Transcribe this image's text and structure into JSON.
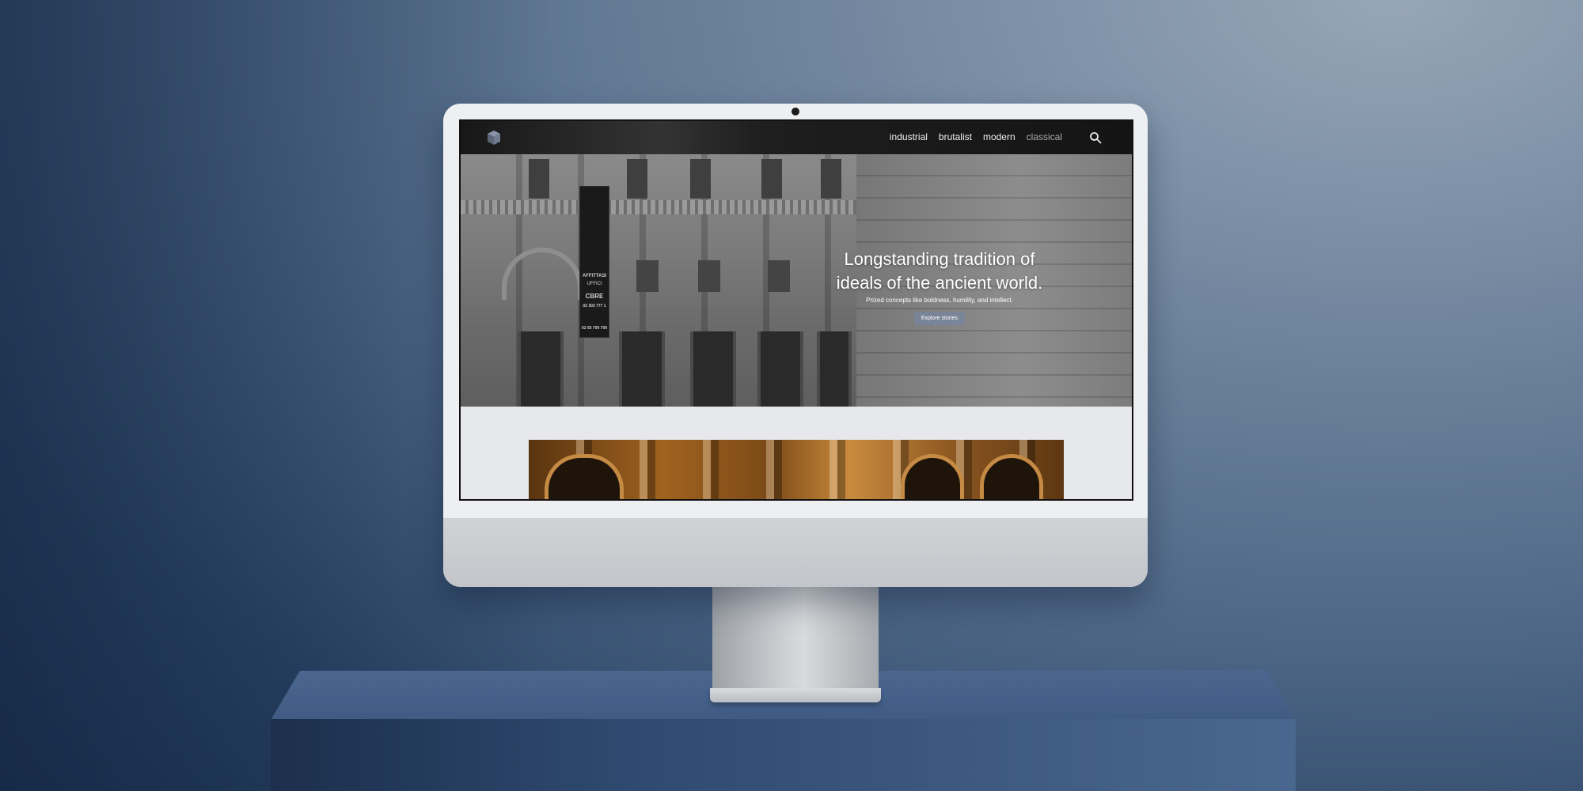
{
  "site": {
    "logo_icon": "cube-logo-icon",
    "nav": {
      "items": [
        {
          "label": "industrial",
          "active": true
        },
        {
          "label": "brutalist",
          "active": true
        },
        {
          "label": "modern",
          "active": true
        },
        {
          "label": "classical",
          "active": false
        }
      ],
      "search_icon": "search-icon"
    },
    "hero": {
      "title_line1": "Longstanding tradition of",
      "title_line2": "ideals of the ancient world.",
      "subtitle": "Prized concepts like boldness, humility, and intellect.",
      "cta_label": "Explore stories",
      "banner_lines": [
        "AFFITTASI",
        "UFFICI",
        "CBRE",
        "02 303 777 1",
        "02 65 799 799"
      ]
    }
  },
  "colors": {
    "background": "#4d6686",
    "nav_bg": "#1e1e1e",
    "content_bg": "#e7e8eb",
    "cta_bg": "#7886a0",
    "monitor_frame": "#eeeff1"
  }
}
